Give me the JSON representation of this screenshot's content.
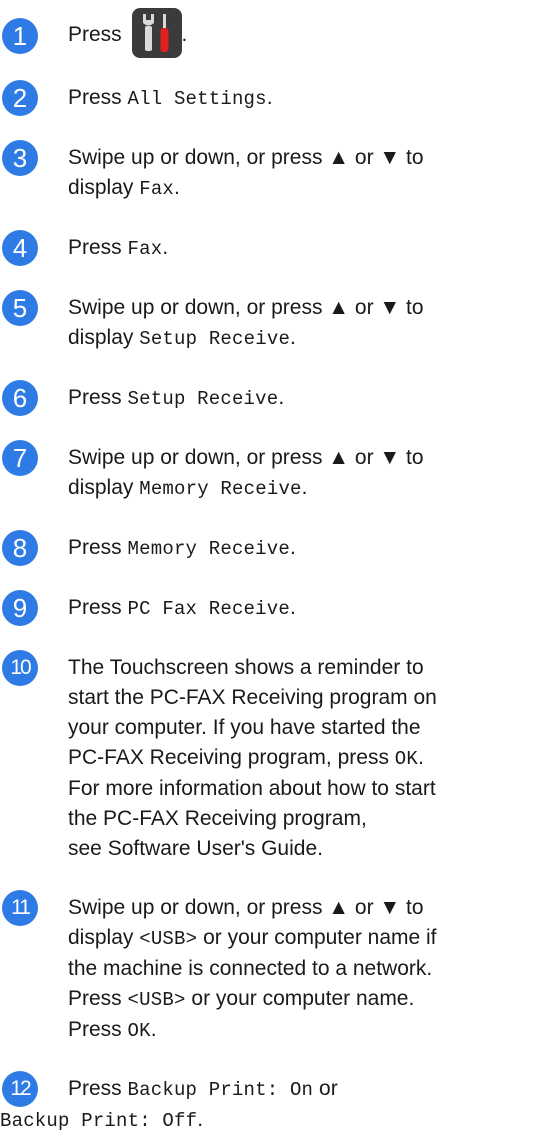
{
  "steps": [
    {
      "num": "1",
      "press": "Press",
      "after": "."
    },
    {
      "num": "2",
      "press": "Press",
      "code": "All Settings",
      "after": "."
    },
    {
      "num": "3",
      "line1": "Swipe up or down, or press ▲ or ▼ to",
      "display": "display",
      "code": "Fax",
      "after": "."
    },
    {
      "num": "4",
      "press": "Press",
      "code": "Fax",
      "after": "."
    },
    {
      "num": "5",
      "line1": "Swipe up or down, or press ▲ or ▼ to",
      "display": "display",
      "code": "Setup Receive",
      "after": "."
    },
    {
      "num": "6",
      "press": "Press",
      "code": "Setup Receive",
      "after": "."
    },
    {
      "num": "7",
      "line1": "Swipe up or down, or press ▲ or ▼ to",
      "display": "display",
      "code": "Memory Receive",
      "after": "."
    },
    {
      "num": "8",
      "press": "Press",
      "code": "Memory Receive",
      "after": "."
    },
    {
      "num": "9",
      "press": "Press",
      "code": "PC Fax Receive",
      "after": "."
    },
    {
      "num": "10",
      "line1": "The Touchscreen shows a reminder to",
      "line2": "start the PC-FAX Receiving program on",
      "line3": "your computer. If you have started the",
      "line4_pre": "PC-FAX Receiving program, press",
      "line4_code": "OK",
      "line4_post": ".",
      "line5": "For more information about how to start",
      "line6": "the PC-FAX Receiving program,",
      "line7": "see Software User's Guide."
    },
    {
      "num": "11",
      "line1": "Swipe up or down, or press ▲ or ▼ to",
      "line2_pre": "display",
      "line2_code": "<USB>",
      "line2_post": "or your computer name if",
      "line3": "the machine is connected to a network.",
      "line4_pre": "Press",
      "line4_code": "<USB>",
      "line4_post": "or your computer name.",
      "line5_pre": "Press",
      "line5_code": "OK",
      "line5_post": "."
    },
    {
      "num": "12",
      "press": "Press",
      "code1": "Backup Print: On",
      "or": "or",
      "code2": "Backup Print: Off",
      "after": "."
    }
  ],
  "colors": {
    "bullet": "#2e7be6",
    "icon_bg": "#3b3b3b"
  },
  "icons": {
    "settings": "settings-wrench-screwdriver-icon"
  }
}
